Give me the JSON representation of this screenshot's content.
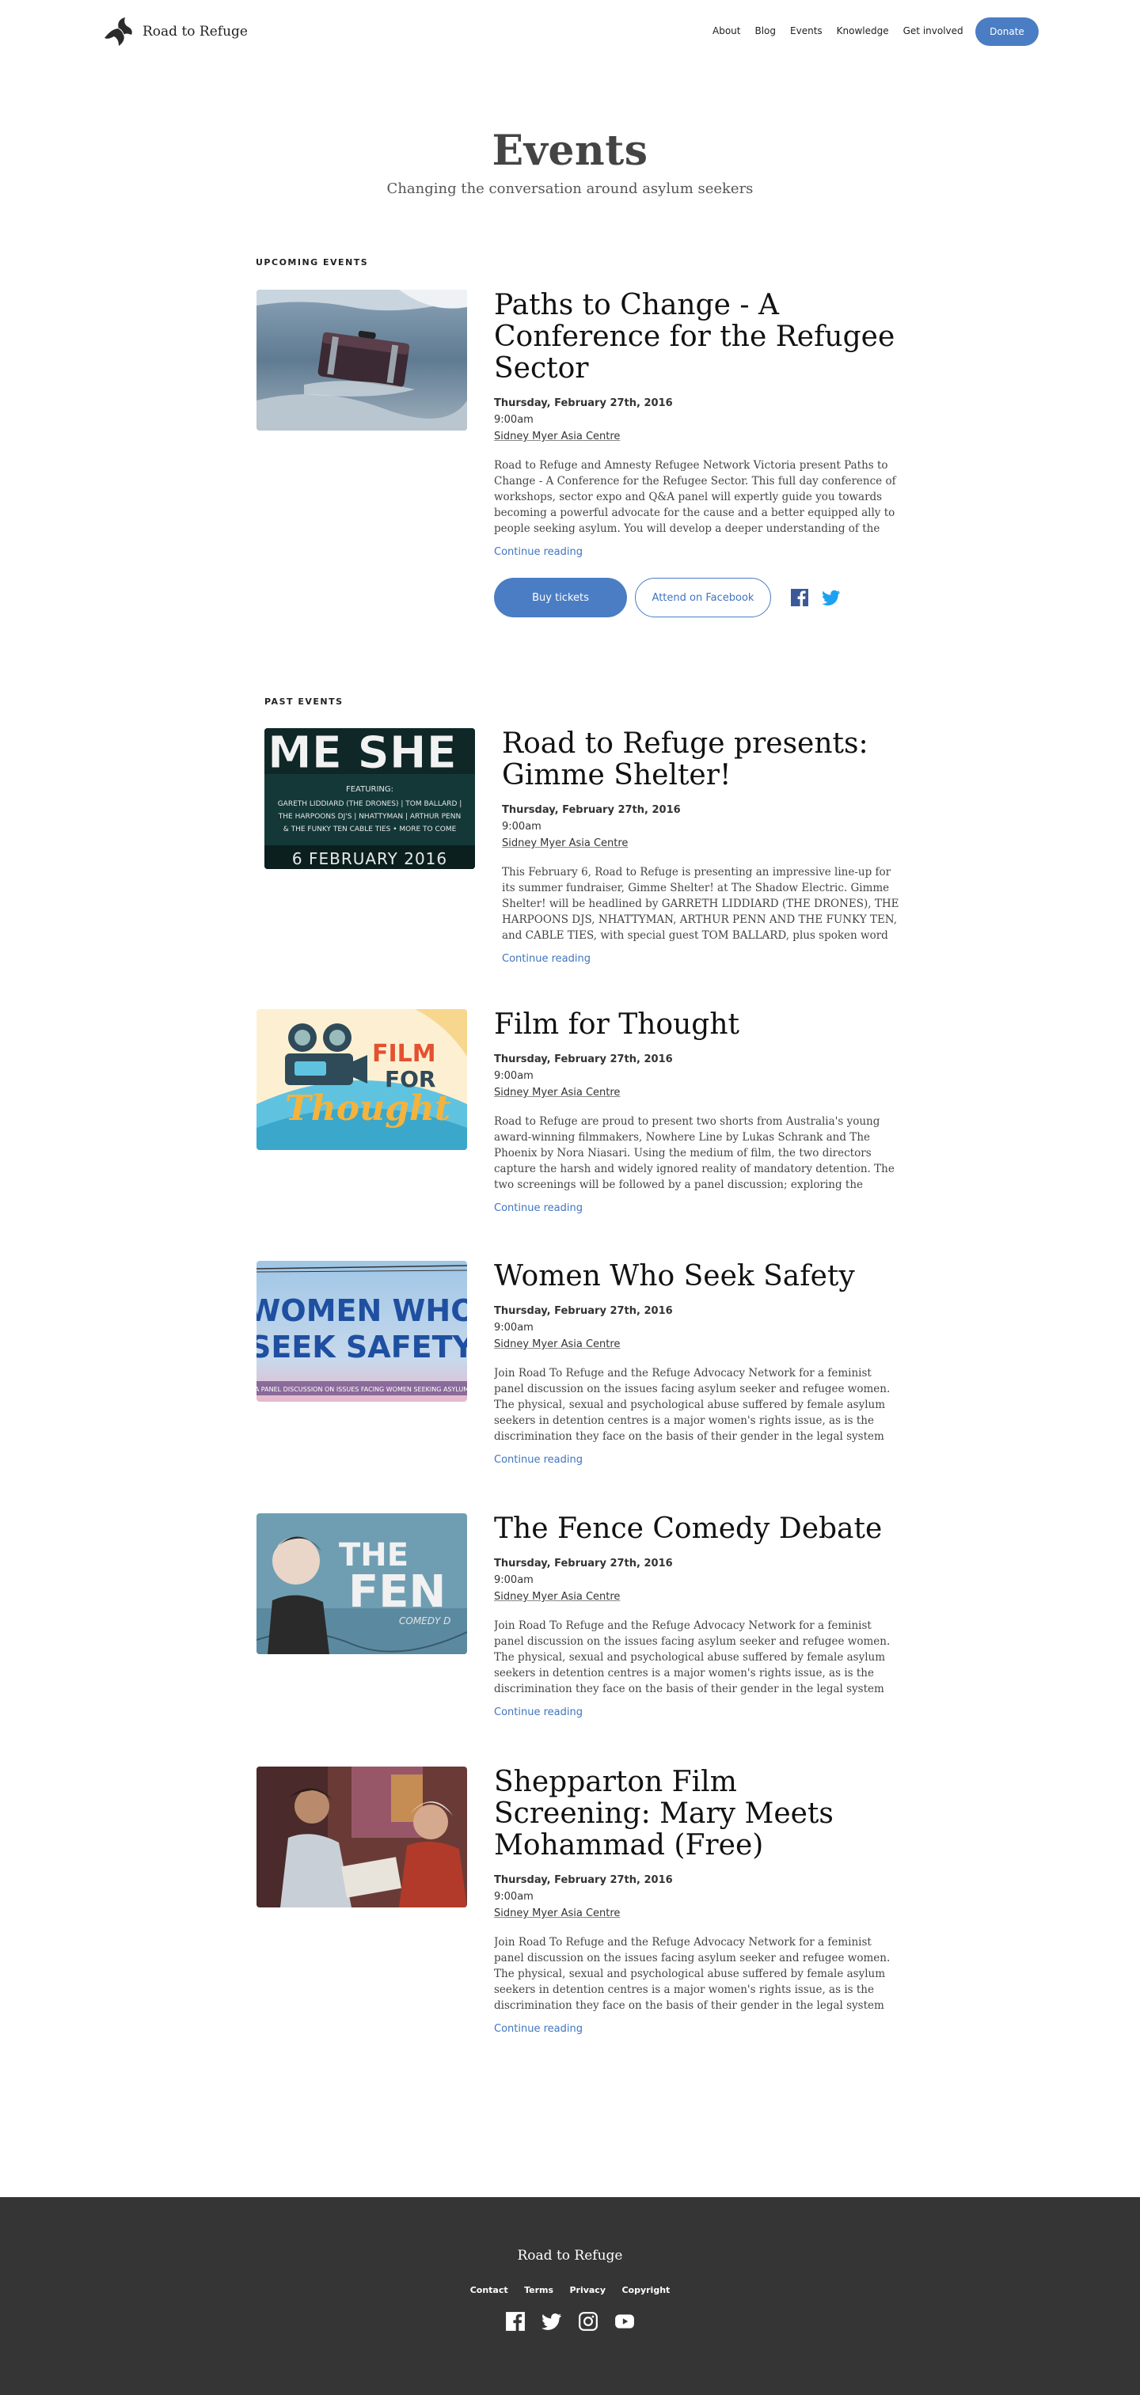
{
  "header": {
    "brand_name": "Road to Refuge",
    "nav": [
      "About",
      "Blog",
      "Events",
      "Knowledge",
      "Get involved"
    ],
    "donate_label": "Donate"
  },
  "hero": {
    "title": "Events",
    "subtitle": "Changing the conversation around asylum seekers"
  },
  "upcoming": {
    "label": "UPCOMING EVENTS",
    "event": {
      "title": "Paths to Change - A Conference for the Refugee Sector",
      "date": "Thursday, February 27th, 2016",
      "time": "9:00am",
      "venue": "Sidney Myer Asia Centre",
      "description": "Road to Refuge and Amnesty Refugee Network Victoria present Paths to Change - A Conference for the Refugee Sector. This full day conference of workshops, sector expo and Q&A panel will expertly guide you towards becoming a powerful advocate for the cause and a better equipped ally to people seeking asylum. You will develop a deeper understanding of the",
      "continue_label": "Continue reading",
      "buy_label": "Buy tickets",
      "facebook_label": "Attend on Facebook"
    }
  },
  "past": {
    "label": "PAST EVENTS",
    "events": [
      {
        "title": "Road to Refuge presents: Gimme Shelter!",
        "date": "Thursday, February 27th, 2016",
        "time": "9:00am",
        "venue": "Sidney Myer Asia Centre",
        "description": "This February 6, Road to Refuge is presenting an impressive line-up for its summer fundraiser, Gimme Shelter! at The Shadow Electric. Gimme Shelter! will be headlined by GARRETH LIDDIARD (THE DRONES), THE HARPOONS DJS, NHATTYMAN, ARTHUR PENN AND THE FUNKY TEN, and CABLE TIES, with special guest TOM BALLARD, plus spoken word poets",
        "continue_label": "Continue reading",
        "poster": {
          "headline": "ME SHE",
          "featuring": "FEATURING:",
          "lineup_1": "GARETH LIDDIARD (THE DRONES) | TOM BALLARD |",
          "lineup_2": "THE HARPOONS DJ'S | NHATTYMAN | ARTHUR PENN",
          "lineup_3": "& THE FUNKY TEN CABLE TIES • MORE TO COME",
          "date": "6 FEBRUARY 2016"
        }
      },
      {
        "title": "Film for Thought",
        "date": "Thursday, February 27th, 2016",
        "time": "9:00am",
        "venue": "Sidney Myer Asia Centre",
        "description": "Road to Refuge are proud to present two shorts from Australia's young award-winning filmmakers, Nowhere Line by Lukas Schrank and The Phoenix by Nora Niasari. Using the medium of film, the two directors capture the harsh and widely ignored reality of mandatory detention. The two screenings will be followed by a panel discussion; exploring the",
        "continue_label": "Continue reading",
        "poster": {
          "film": "FILM",
          "for": "FOR",
          "thought": "Thought"
        }
      },
      {
        "title": "Women Who Seek Safety",
        "date": "Thursday, February 27th, 2016",
        "time": "9:00am",
        "venue": "Sidney Myer Asia Centre",
        "description": "Join Road To Refuge and the Refuge Advocacy Network for a feminist panel discussion on the issues facing asylum seeker and refugee women. The physical, sexual and psychological abuse suffered by female asylum seekers in detention centres is a major women's rights issue, as is the discrimination they face on the basis of their gender in the legal system",
        "continue_label": "Continue reading",
        "poster": {
          "line1": "WOMEN WHO",
          "line2": "SEEK SAFETY",
          "caption": "A PANEL DISCUSSION ON ISSUES FACING WOMEN SEEKING ASYLUM"
        }
      },
      {
        "title": "The Fence Comedy Debate",
        "date": "Thursday, February 27th, 2016",
        "time": "9:00am",
        "venue": "Sidney Myer Asia Centre",
        "description": "Join Road To Refuge and the Refuge Advocacy Network for a feminist panel discussion on the issues facing asylum seeker and refugee women. The physical, sexual and psychological abuse suffered by female asylum seekers in detention centres is a major women's rights issue, as is the discrimination they face on the basis of their gender in the legal system",
        "continue_label": "Continue reading",
        "poster": {
          "the": "THE",
          "fen": "FEN",
          "comedy": "COMEDY D"
        }
      },
      {
        "title": "Shepparton Film Screening: Mary Meets Mohammad (Free)",
        "date": "Thursday, February 27th, 2016",
        "time": "9:00am",
        "venue": "Sidney Myer Asia Centre",
        "description": "Join Road To Refuge and the Refuge Advocacy Network for a feminist panel discussion on the issues facing asylum seeker and refugee women. The physical, sexual and psychological abuse suffered by female asylum seekers in detention centres is a major women's rights issue, as is the discrimination they face on the basis of their gender in the legal system",
        "continue_label": "Continue reading"
      }
    ]
  },
  "footer": {
    "brand_name": "Road to Refuge",
    "links": [
      "Contact",
      "Terms",
      "Privacy",
      "Copyright"
    ],
    "social": [
      "facebook-icon",
      "twitter-icon",
      "instagram-icon",
      "youtube-icon"
    ]
  },
  "colors": {
    "accent": "#4a7dc4",
    "highlight": "#f7e27a",
    "footer_bg": "#353535"
  }
}
